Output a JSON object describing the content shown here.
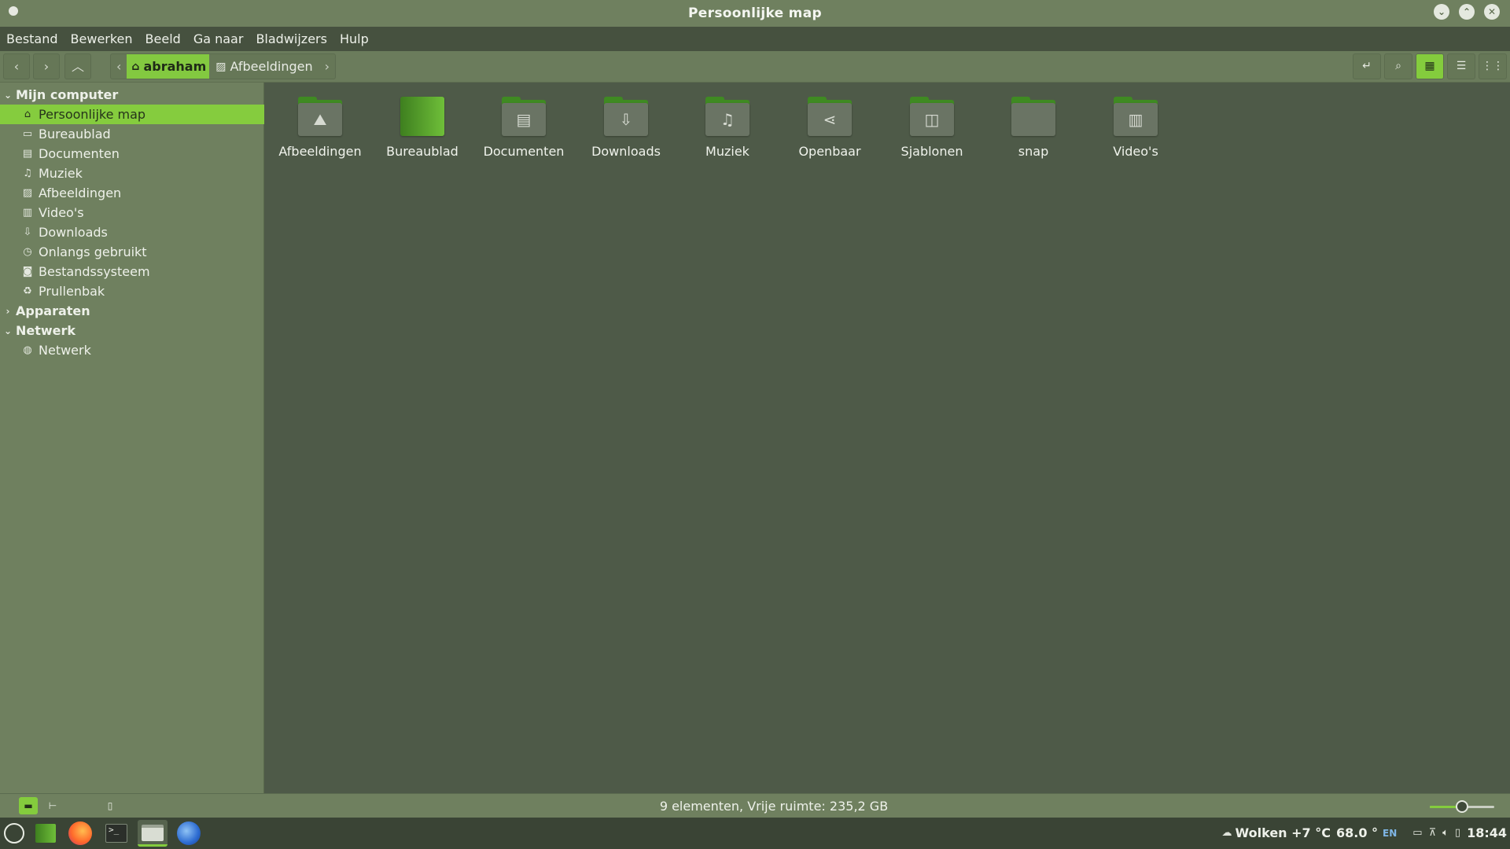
{
  "window": {
    "title": "Persoonlijke map"
  },
  "menu": [
    "Bestand",
    "Bewerken",
    "Beeld",
    "Ga naar",
    "Bladwijzers",
    "Hulp"
  ],
  "breadcrumb": [
    {
      "label": "abraham",
      "icon": "home-icon",
      "active": true
    },
    {
      "label": "Afbeeldingen",
      "icon": "image-icon",
      "active": false
    }
  ],
  "sidebar": {
    "sections": [
      {
        "label": "Mijn computer",
        "expanded": true
      },
      {
        "label": "Apparaten",
        "expanded": false
      },
      {
        "label": "Netwerk",
        "expanded": true
      }
    ],
    "items": [
      {
        "label": "Persoonlijke map",
        "icon": "home-icon",
        "selected": true
      },
      {
        "label": "Bureaublad",
        "icon": "desktop-icon"
      },
      {
        "label": "Documenten",
        "icon": "document-icon"
      },
      {
        "label": "Muziek",
        "icon": "music-icon"
      },
      {
        "label": "Afbeeldingen",
        "icon": "image-icon"
      },
      {
        "label": "Video's",
        "icon": "film-icon"
      },
      {
        "label": "Downloads",
        "icon": "download-icon"
      },
      {
        "label": "Onlangs gebruikt",
        "icon": "clock-icon"
      },
      {
        "label": "Bestandssysteem",
        "icon": "drive-icon"
      },
      {
        "label": "Prullenbak",
        "icon": "trash-icon"
      }
    ],
    "network_items": [
      {
        "label": "Netwerk",
        "icon": "globe-icon"
      }
    ]
  },
  "files": [
    {
      "label": "Afbeeldingen",
      "icon": "image-icon"
    },
    {
      "label": "Bureaublad",
      "icon": "desktop-icon"
    },
    {
      "label": "Documenten",
      "icon": "document-icon"
    },
    {
      "label": "Downloads",
      "icon": "download-icon"
    },
    {
      "label": "Muziek",
      "icon": "music-icon"
    },
    {
      "label": "Openbaar",
      "icon": "share-icon"
    },
    {
      "label": "Sjablonen",
      "icon": "template-icon"
    },
    {
      "label": "snap",
      "icon": "folder-icon"
    },
    {
      "label": "Video's",
      "icon": "film-icon"
    }
  ],
  "status": {
    "text": "9 elementen, Vrije ruimte: 235,2 GB",
    "zoom_fraction": 0.5
  },
  "taskbar": {
    "weather": "Wolken +7 °C",
    "value": "68.0 °",
    "lang": "EN",
    "clock": "18:44"
  },
  "colors": {
    "accent": "#84cc3d",
    "titlebar": "#6f805f",
    "main_bg": "#4e5a48"
  }
}
